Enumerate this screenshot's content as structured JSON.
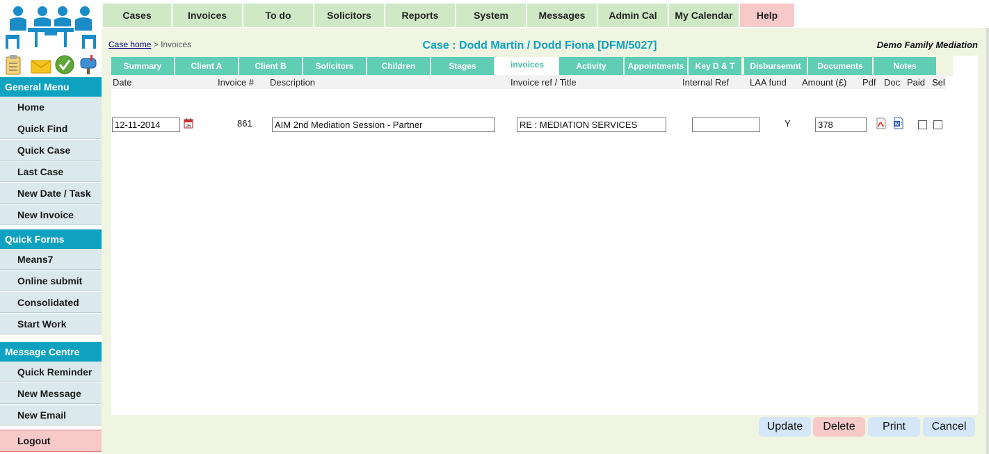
{
  "app": {
    "firm_name": "Demo Family Mediation"
  },
  "topnav": {
    "items": [
      "Cases",
      "Invoices",
      "To do",
      "Solicitors",
      "Reports",
      "System",
      "Messages",
      "Admin Cal",
      "My Calendar",
      "Help"
    ]
  },
  "sidebar": {
    "general_menu_title": "General Menu",
    "general_menu": [
      "Home",
      "Quick Find",
      "Quick Case",
      "Last Case",
      "New Date / Task",
      "New Invoice"
    ],
    "quick_forms_title": "Quick Forms",
    "quick_forms": [
      "Means7",
      "Online submit",
      "Consolidated",
      "Start Work"
    ],
    "message_centre_title": "Message Centre",
    "message_centre": [
      "Quick Reminder",
      "New Message",
      "New Email"
    ],
    "logout": "Logout",
    "quick_icons": [
      "clipboard-icon",
      "mail-icon",
      "checkmark-icon",
      "mailbox-icon"
    ]
  },
  "breadcrumb": {
    "link": "Case home",
    "separator": ">",
    "current": "Invoices"
  },
  "case_title": "Case : Dodd Martin / Dodd Fiona [DFM/5027]",
  "subtabs": {
    "items": [
      "Summary",
      "Client A",
      "Client B",
      "Solicitors",
      "Children",
      "Stages",
      "invoices",
      "Activity",
      "Appointments",
      "Key D & T",
      "Disbursemnt",
      "Documents",
      "Notes"
    ],
    "active": "invoices"
  },
  "invoice_table": {
    "columns": [
      "Date",
      "Invoice #",
      "Description",
      "Invoice ref / Title",
      "Internal Ref",
      "LAA fund",
      "Amount (£)",
      "Pdf",
      "Doc",
      "Paid",
      "Sel"
    ],
    "rows": [
      {
        "date": "12-11-2014",
        "invoice_no": "861",
        "description": "AIM 2nd Mediation Session - Partner",
        "ref_title": "RE : MEDIATION SERVICES",
        "internal_ref": "",
        "laa_fund": "Y",
        "amount": "378",
        "paid": false,
        "sel": false
      }
    ]
  },
  "buttons": {
    "update": "Update",
    "delete": "Delete",
    "print": "Print",
    "cancel": "Cancel"
  },
  "colors": {
    "accent": "#0fa2c0",
    "subtab": "#60cdb5",
    "nav": "#cfe9c6",
    "danger": "#f7c9c9",
    "main_bg": "#f0f5e2"
  }
}
